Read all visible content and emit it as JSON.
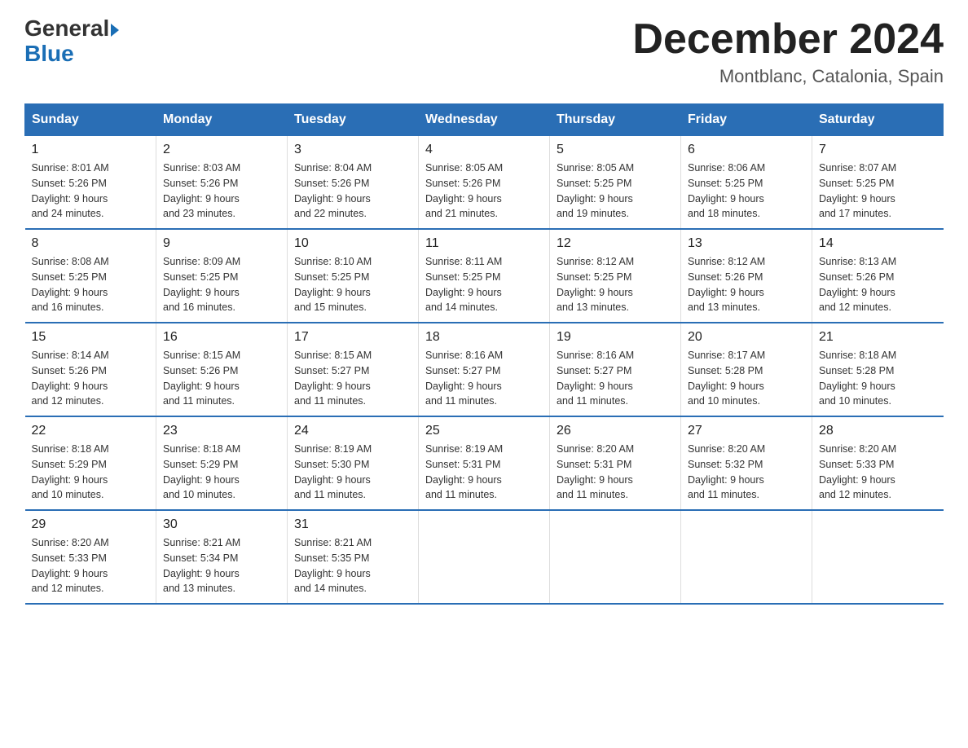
{
  "header": {
    "logo_general": "General",
    "logo_blue": "Blue",
    "month_title": "December 2024",
    "location": "Montblanc, Catalonia, Spain"
  },
  "days_of_week": [
    "Sunday",
    "Monday",
    "Tuesday",
    "Wednesday",
    "Thursday",
    "Friday",
    "Saturday"
  ],
  "weeks": [
    [
      {
        "day": "1",
        "sunrise": "8:01 AM",
        "sunset": "5:26 PM",
        "daylight": "9 hours and 24 minutes."
      },
      {
        "day": "2",
        "sunrise": "8:03 AM",
        "sunset": "5:26 PM",
        "daylight": "9 hours and 23 minutes."
      },
      {
        "day": "3",
        "sunrise": "8:04 AM",
        "sunset": "5:26 PM",
        "daylight": "9 hours and 22 minutes."
      },
      {
        "day": "4",
        "sunrise": "8:05 AM",
        "sunset": "5:26 PM",
        "daylight": "9 hours and 21 minutes."
      },
      {
        "day": "5",
        "sunrise": "8:05 AM",
        "sunset": "5:25 PM",
        "daylight": "9 hours and 19 minutes."
      },
      {
        "day": "6",
        "sunrise": "8:06 AM",
        "sunset": "5:25 PM",
        "daylight": "9 hours and 18 minutes."
      },
      {
        "day": "7",
        "sunrise": "8:07 AM",
        "sunset": "5:25 PM",
        "daylight": "9 hours and 17 minutes."
      }
    ],
    [
      {
        "day": "8",
        "sunrise": "8:08 AM",
        "sunset": "5:25 PM",
        "daylight": "9 hours and 16 minutes."
      },
      {
        "day": "9",
        "sunrise": "8:09 AM",
        "sunset": "5:25 PM",
        "daylight": "9 hours and 16 minutes."
      },
      {
        "day": "10",
        "sunrise": "8:10 AM",
        "sunset": "5:25 PM",
        "daylight": "9 hours and 15 minutes."
      },
      {
        "day": "11",
        "sunrise": "8:11 AM",
        "sunset": "5:25 PM",
        "daylight": "9 hours and 14 minutes."
      },
      {
        "day": "12",
        "sunrise": "8:12 AM",
        "sunset": "5:25 PM",
        "daylight": "9 hours and 13 minutes."
      },
      {
        "day": "13",
        "sunrise": "8:12 AM",
        "sunset": "5:26 PM",
        "daylight": "9 hours and 13 minutes."
      },
      {
        "day": "14",
        "sunrise": "8:13 AM",
        "sunset": "5:26 PM",
        "daylight": "9 hours and 12 minutes."
      }
    ],
    [
      {
        "day": "15",
        "sunrise": "8:14 AM",
        "sunset": "5:26 PM",
        "daylight": "9 hours and 12 minutes."
      },
      {
        "day": "16",
        "sunrise": "8:15 AM",
        "sunset": "5:26 PM",
        "daylight": "9 hours and 11 minutes."
      },
      {
        "day": "17",
        "sunrise": "8:15 AM",
        "sunset": "5:27 PM",
        "daylight": "9 hours and 11 minutes."
      },
      {
        "day": "18",
        "sunrise": "8:16 AM",
        "sunset": "5:27 PM",
        "daylight": "9 hours and 11 minutes."
      },
      {
        "day": "19",
        "sunrise": "8:16 AM",
        "sunset": "5:27 PM",
        "daylight": "9 hours and 11 minutes."
      },
      {
        "day": "20",
        "sunrise": "8:17 AM",
        "sunset": "5:28 PM",
        "daylight": "9 hours and 10 minutes."
      },
      {
        "day": "21",
        "sunrise": "8:18 AM",
        "sunset": "5:28 PM",
        "daylight": "9 hours and 10 minutes."
      }
    ],
    [
      {
        "day": "22",
        "sunrise": "8:18 AM",
        "sunset": "5:29 PM",
        "daylight": "9 hours and 10 minutes."
      },
      {
        "day": "23",
        "sunrise": "8:18 AM",
        "sunset": "5:29 PM",
        "daylight": "9 hours and 10 minutes."
      },
      {
        "day": "24",
        "sunrise": "8:19 AM",
        "sunset": "5:30 PM",
        "daylight": "9 hours and 11 minutes."
      },
      {
        "day": "25",
        "sunrise": "8:19 AM",
        "sunset": "5:31 PM",
        "daylight": "9 hours and 11 minutes."
      },
      {
        "day": "26",
        "sunrise": "8:20 AM",
        "sunset": "5:31 PM",
        "daylight": "9 hours and 11 minutes."
      },
      {
        "day": "27",
        "sunrise": "8:20 AM",
        "sunset": "5:32 PM",
        "daylight": "9 hours and 11 minutes."
      },
      {
        "day": "28",
        "sunrise": "8:20 AM",
        "sunset": "5:33 PM",
        "daylight": "9 hours and 12 minutes."
      }
    ],
    [
      {
        "day": "29",
        "sunrise": "8:20 AM",
        "sunset": "5:33 PM",
        "daylight": "9 hours and 12 minutes."
      },
      {
        "day": "30",
        "sunrise": "8:21 AM",
        "sunset": "5:34 PM",
        "daylight": "9 hours and 13 minutes."
      },
      {
        "day": "31",
        "sunrise": "8:21 AM",
        "sunset": "5:35 PM",
        "daylight": "9 hours and 14 minutes."
      },
      null,
      null,
      null,
      null
    ]
  ],
  "labels": {
    "sunrise": "Sunrise:",
    "sunset": "Sunset:",
    "daylight": "Daylight:"
  }
}
